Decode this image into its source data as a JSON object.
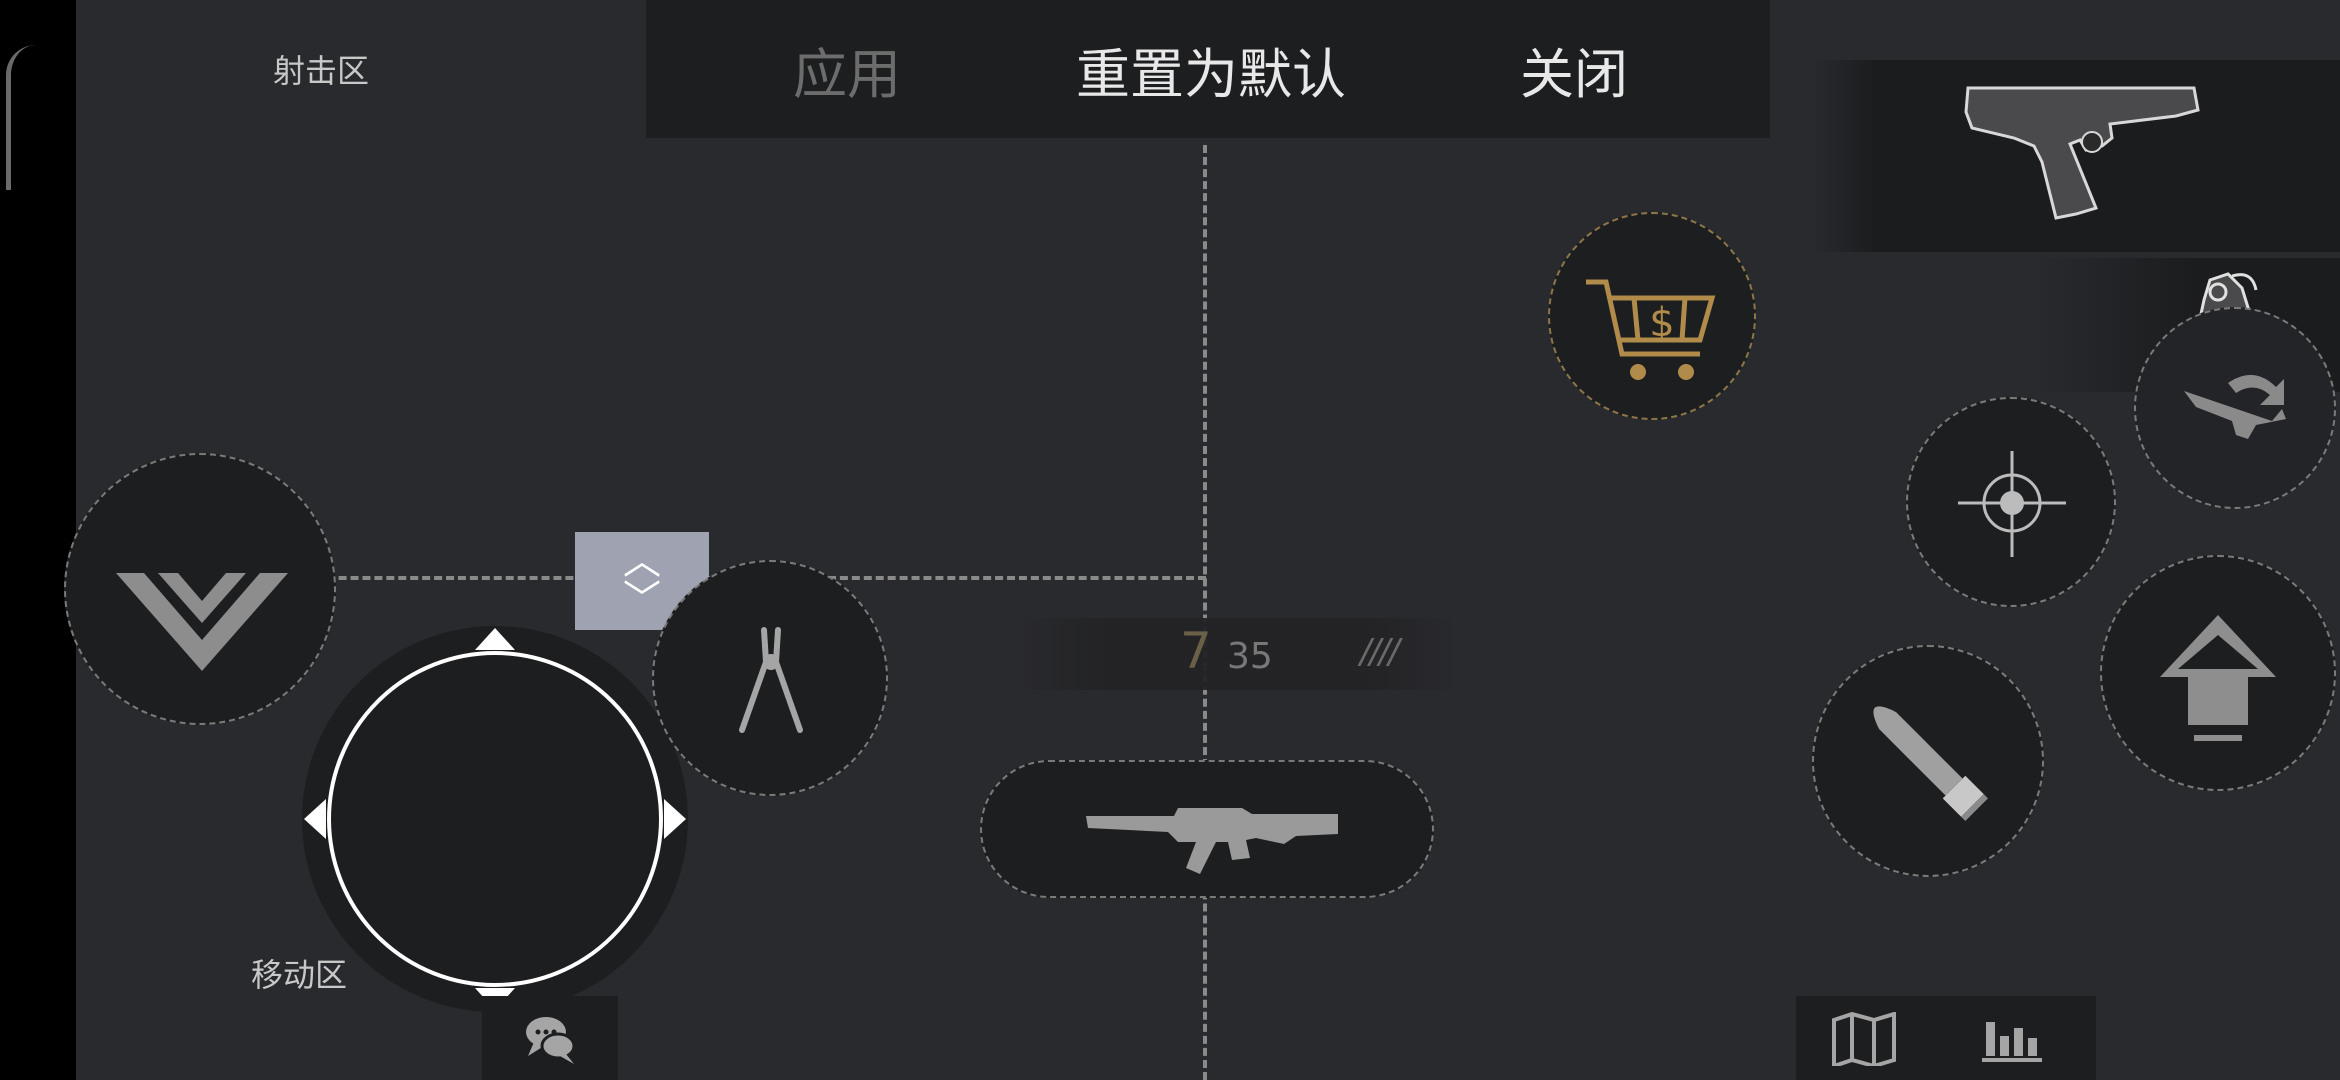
{
  "zones": {
    "shoot_label": "射击区",
    "move_label": "移动区"
  },
  "top_bar": {
    "apply_label": "应用",
    "reset_label": "重置为默认",
    "close_label": "关闭"
  },
  "resize_handle": {
    "up_glyph": "︿",
    "down_glyph": "﹀"
  },
  "ammo": {
    "magazine": "7",
    "reserve": "35",
    "fire_mode": "////"
  },
  "icons": {
    "crouch": "chevron-down-icon",
    "pliers": "defuse-kit-icon",
    "shop": "shopping-cart-icon",
    "aim": "crosshair-icon",
    "swap": "weapon-swap-icon",
    "jump": "jump-arrow-icon",
    "reload": "bullet-icon",
    "primary_weapon": "rifle-icon",
    "pistol": "pistol-icon",
    "grenade": "grenade-icon",
    "chat": "chat-icon",
    "map": "map-icon",
    "scoreboard": "bar-chart-icon"
  },
  "colors": {
    "background": "#292a2e",
    "panel": "#1d1e20",
    "shop_accent": "#b08b4a",
    "dashed_guides": "#8a8a8a"
  }
}
